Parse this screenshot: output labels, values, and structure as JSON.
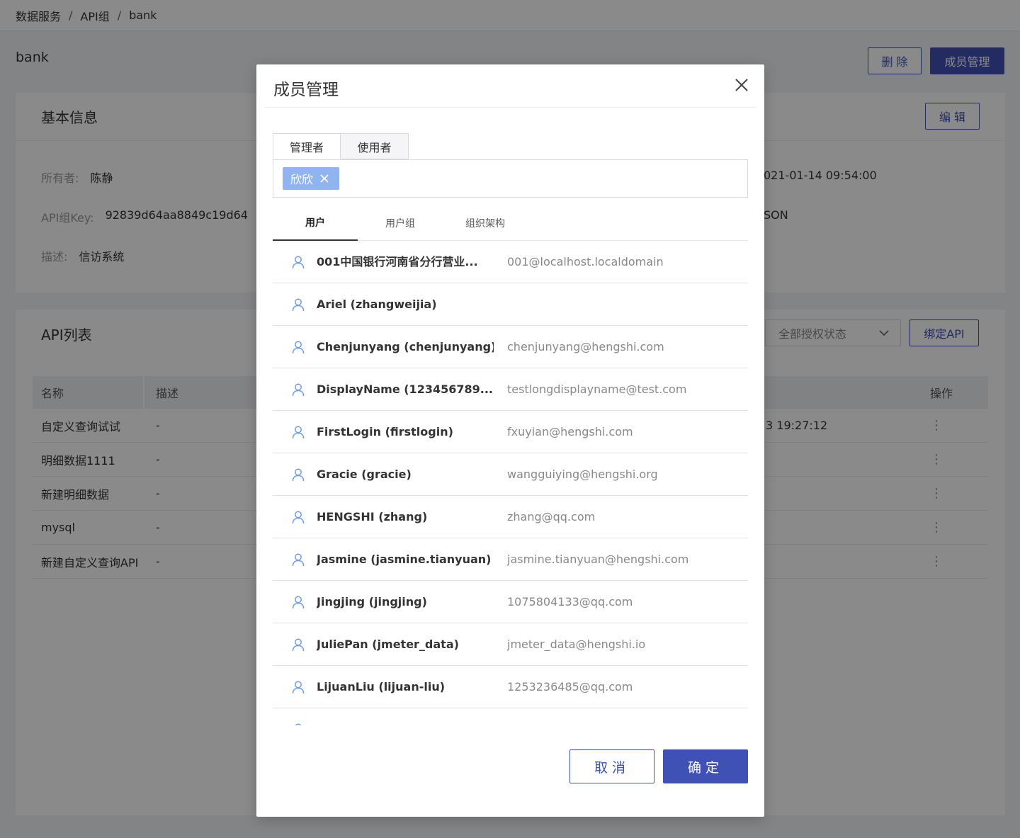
{
  "breadcrumb": [
    "数据服务",
    "API组",
    "bank"
  ],
  "page": {
    "title": "bank",
    "delete_label": "删 除",
    "members_label": "成员管理"
  },
  "basic_info": {
    "title": "基本信息",
    "edit_label": "编 辑",
    "owner_label": "所有者:",
    "owner_value": "陈静",
    "key_label": "API组Key:",
    "key_value": "92839d64aa8849c19d64",
    "desc_label": "描述:",
    "desc_value": "信访系统",
    "time_value": "021-01-14 09:54:00",
    "format_value": "SON"
  },
  "api_list": {
    "title": "API列表",
    "filter_value": "全部授权状态",
    "bind_label": "绑定API",
    "headers": [
      "名称",
      "描述",
      "操作"
    ],
    "rows": [
      {
        "name": "自定义查询试试",
        "desc": "-",
        "time": "3 19:27:12"
      },
      {
        "name": "明细数据1111",
        "desc": "-",
        "time": ""
      },
      {
        "name": "新建明细数据",
        "desc": "-",
        "time": ""
      },
      {
        "name": "mysql",
        "desc": "-",
        "time": ""
      },
      {
        "name": "新建自定义查询API",
        "desc": "-",
        "time": ""
      }
    ]
  },
  "modal": {
    "title": "成员管理",
    "role_tabs": [
      "管理者",
      "使用者"
    ],
    "selected_chip": "欣欣",
    "sub_tabs": [
      "用户",
      "用户组",
      "组织架构"
    ],
    "users": [
      {
        "name": "001中国银行河南省分行营业...",
        "email": "001@localhost.localdomain"
      },
      {
        "name": "Ariel (zhangweijia)",
        "email": ""
      },
      {
        "name": "Chenjunyang (chenjunyang)",
        "email": "chenjunyang@hengshi.com"
      },
      {
        "name": "DisplayName (123456789...",
        "email": "testlongdisplayname@test.com"
      },
      {
        "name": "FirstLogin (firstlogin)",
        "email": "fxuyian@hengshi.com"
      },
      {
        "name": "Gracie (gracie)",
        "email": "wangguiying@hengshi.org"
      },
      {
        "name": "HENGSHI (zhang)",
        "email": "zhang@qq.com"
      },
      {
        "name": "Jasmine (jasmine.tianyuan)",
        "email": "jasmine.tianyuan@hengshi.com"
      },
      {
        "name": "Jingjing (jingjing)",
        "email": "1075804133@qq.com"
      },
      {
        "name": "JuliePan (jmeter_data)",
        "email": "jmeter_data@hengshi.io"
      },
      {
        "name": "LijuanLiu (lijuan-liu)",
        "email": "1253236485@qq.com"
      },
      {
        "name": "",
        "email": ""
      }
    ],
    "cancel_label": "取消",
    "ok_label": "确定"
  }
}
